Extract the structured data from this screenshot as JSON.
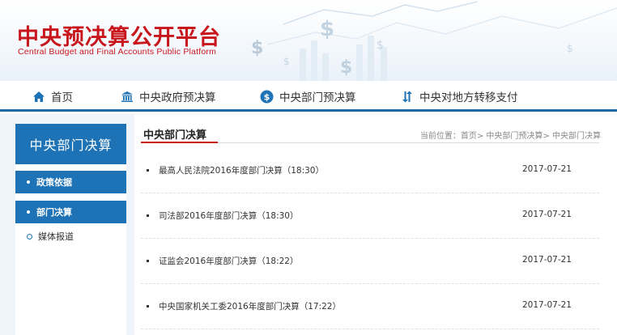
{
  "header": {
    "title": "中央预决算公开平台",
    "subtitle": "Central Budget and Final Accounts Public Platform"
  },
  "nav": {
    "items": [
      {
        "label": "首页",
        "icon": "home-icon"
      },
      {
        "label": "中央政府预决算",
        "icon": "government-building-icon"
      },
      {
        "label": "中央部门预决算",
        "icon": "dollar-circle-icon"
      },
      {
        "label": "中央对地方转移支付",
        "icon": "transfer-arrows-icon"
      }
    ]
  },
  "sidebar": {
    "heading": "中央部门决算",
    "items": [
      {
        "label": "政策依据",
        "active": true
      },
      {
        "label": "部门决算",
        "active": true
      },
      {
        "label": "媒体报道",
        "active": false
      }
    ]
  },
  "main": {
    "title": "中央部门决算",
    "breadcrumb": "当前位置：首页> 中央部门预决算> 中央部门决算",
    "rows": [
      {
        "title": "最高人民法院2016年度部门决算（18:30）",
        "date": "2017-07-21"
      },
      {
        "title": "司法部2016年度部门决算（18:30）",
        "date": "2017-07-21"
      },
      {
        "title": "证监会2016年度部门决算（18:22）",
        "date": "2017-07-21"
      },
      {
        "title": "中央国家机关工委2016年度部门决算（17:22）",
        "date": "2017-07-21"
      }
    ]
  },
  "colors": {
    "brand_red": "#c8161d",
    "accent_blue": "#1d73b6",
    "nav_border": "#1a6aa8"
  }
}
